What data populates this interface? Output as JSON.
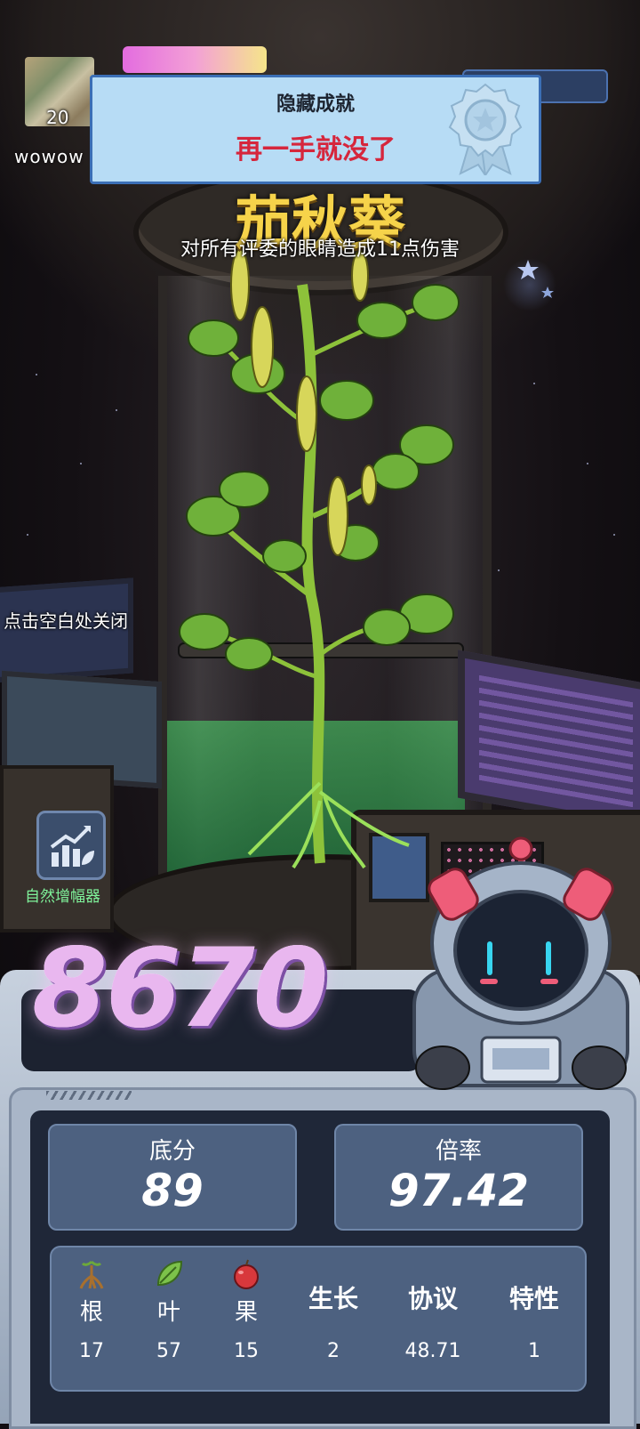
{
  "player": {
    "level": "20",
    "name": "wowow"
  },
  "achievement": {
    "title": "隐藏成就",
    "name": "再一手就没了"
  },
  "plant": {
    "name": "茄秋葵",
    "description": "对所有评委的眼睛造成11点伤害"
  },
  "hint": {
    "close": "点击空白处关闭"
  },
  "booster": {
    "label": "自然增幅器"
  },
  "score": {
    "total": "8670",
    "base_label": "底分",
    "base_value": "89",
    "multiplier_label": "倍率",
    "multiplier_value": "97.42"
  },
  "attributes": [
    {
      "label": "根",
      "value": "17",
      "icon": "root-icon"
    },
    {
      "label": "叶",
      "value": "57",
      "icon": "leaf-icon"
    },
    {
      "label": "果",
      "value": "15",
      "icon": "fruit-icon"
    },
    {
      "label": "生长",
      "value": "2"
    },
    {
      "label": "协议",
      "value": "48.71"
    },
    {
      "label": "特性",
      "value": "1"
    }
  ],
  "colors": {
    "achievement_bg": "#b7dcf5",
    "achievement_name": "#d6263c",
    "plant_name": "#f6d34a",
    "booster_label": "#7ff29a",
    "score": "#e9b7ef"
  }
}
